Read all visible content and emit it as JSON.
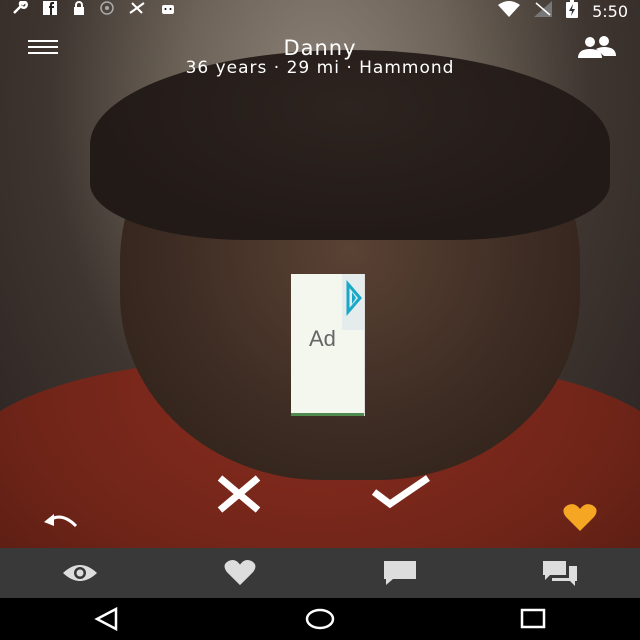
{
  "status_bar": {
    "time": "5:50",
    "left_icons": [
      "wrench-icon",
      "facebook-icon",
      "lock-icon",
      "settings-icon",
      "fax-icon",
      "android-icon"
    ],
    "right_icons": [
      "wifi-icon",
      "no-signal-icon",
      "battery-icon"
    ]
  },
  "profile": {
    "name": "Danny",
    "details": "36 years · 29 mi · Hammond"
  },
  "ad": {
    "label": "Ad"
  },
  "actions": {
    "reject_icon": "close-icon",
    "accept_icon": "check-icon",
    "undo_icon": "undo-icon",
    "favorite_icon": "heart-icon",
    "favorite_color": "#f5a623"
  },
  "tabs": [
    {
      "icon": "eye-icon"
    },
    {
      "icon": "heart-icon"
    },
    {
      "icon": "chat-icon"
    },
    {
      "icon": "chats-icon"
    }
  ],
  "nav": [
    "back-icon",
    "home-icon",
    "recents-icon"
  ]
}
